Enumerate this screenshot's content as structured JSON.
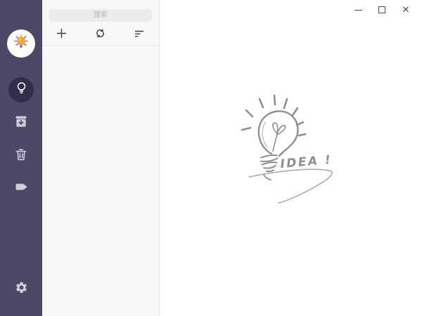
{
  "titlebar": {
    "minimize_icon": "minimize-line",
    "maximize_icon": "maximize-square",
    "close_glyph": "✕"
  },
  "search": {
    "placeholder": "搜索",
    "value": ""
  },
  "sidebar": {
    "avatar_icon": "lightbulb-emoji",
    "items": [
      {
        "name": "notes",
        "icon": "lightbulb-icon",
        "active": true
      },
      {
        "name": "archive",
        "icon": "archive-icon",
        "active": false
      },
      {
        "name": "trash",
        "icon": "trash-icon",
        "active": false
      },
      {
        "name": "tags",
        "icon": "tag-icon",
        "active": false
      }
    ],
    "settings_icon": "gear-icon"
  },
  "toolbar": {
    "add_icon": "plus-icon",
    "sync_icon": "sync-icon",
    "sort_icon": "sort-icon"
  },
  "note_list": {
    "items": []
  },
  "main": {
    "empty_state": {
      "caption": "IDEA !"
    }
  },
  "colors": {
    "sidebar_bg": "#4e4866",
    "sidebar_active_bg": "#332d49",
    "sidebar_icon": "#cfced8",
    "panel_bg": "#f8f8f8",
    "search_bg": "#ececec",
    "toolbar_icon": "#3f3f3f",
    "sketch_stroke": "#969696",
    "emoji_bulb": "#f2a33c"
  }
}
